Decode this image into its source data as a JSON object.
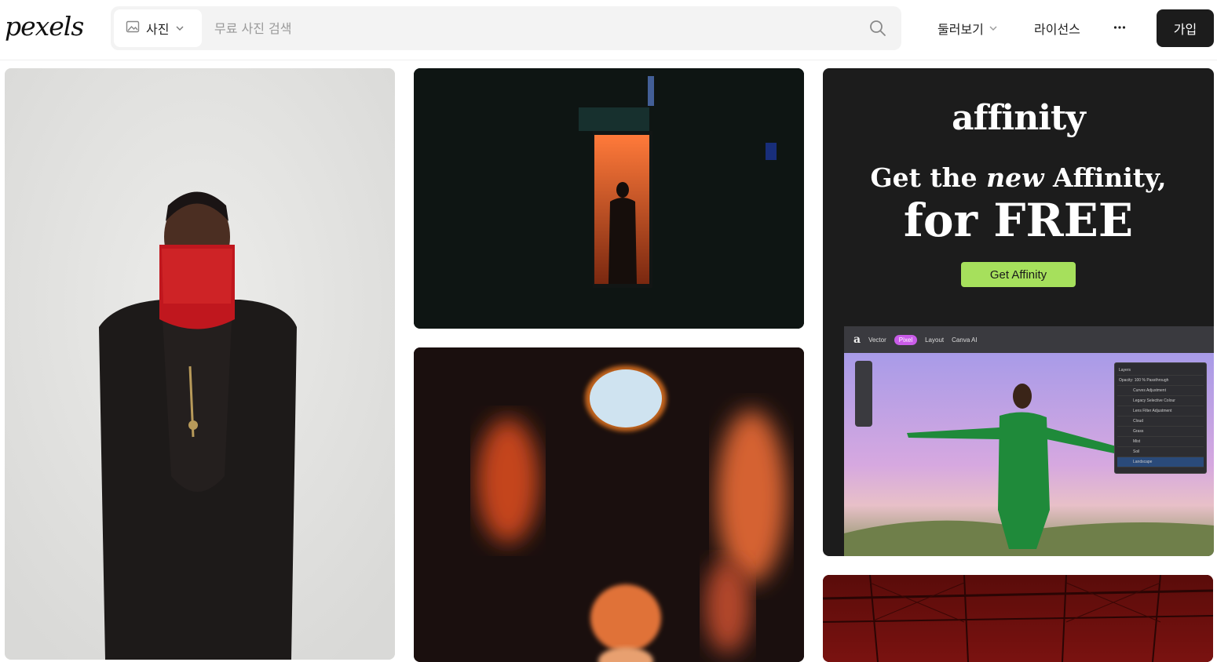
{
  "header": {
    "logo": "pexels",
    "search": {
      "type_label": "사진",
      "placeholder": "무료 사진 검색"
    },
    "nav": {
      "explore": "둘러보기",
      "license": "라이선스",
      "join": "가입"
    }
  },
  "ad": {
    "logo": "affinity",
    "headline_pre": "Get the ",
    "headline_em": "new",
    "headline_post": " Affinity,",
    "headline2": "for FREE",
    "cta": "Get Affinity",
    "app": {
      "tabs": [
        "Vector",
        "Pixel",
        "Layout",
        "Canva AI"
      ],
      "layers": [
        "Curves Adjustment",
        "Legacy Selective Colour",
        "Lens Filter Adjustment",
        "Cloud",
        "Grass",
        "Mist",
        "Soil",
        "Landscape"
      ],
      "panel_title": "Layers",
      "opacity_label": "Opacity:",
      "opacity_value": "100 %",
      "blend_mode": "Passthrough"
    }
  },
  "colors": {
    "accent_cta": "#a6e05c",
    "join_bg": "#1c1c1c",
    "pixel_pill": "#c95ce8"
  }
}
